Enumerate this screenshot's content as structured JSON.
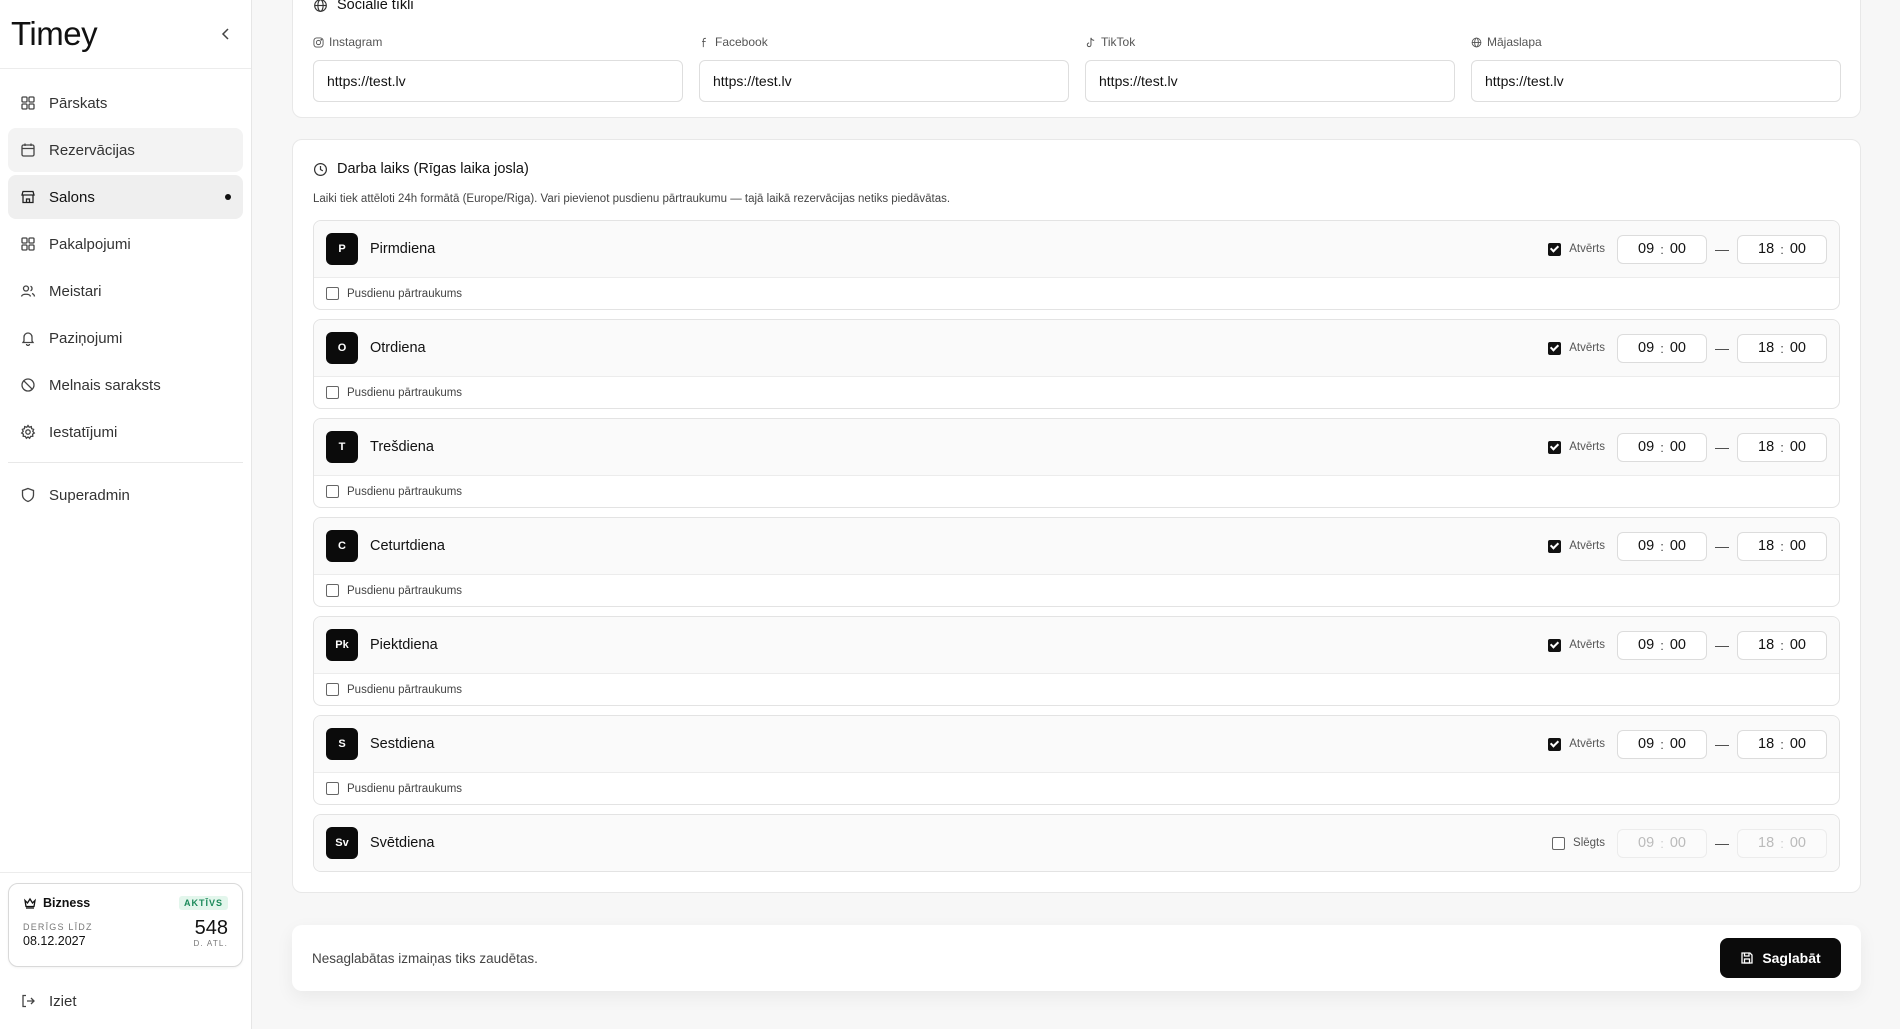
{
  "app": {
    "logo": "Timey"
  },
  "sidebar": {
    "items": [
      {
        "label": "Pārskats",
        "icon": "dashboard-icon"
      },
      {
        "label": "Rezervācijas",
        "icon": "calendar-icon"
      },
      {
        "label": "Salons",
        "icon": "store-icon",
        "active": true
      },
      {
        "label": "Pakalpojumi",
        "icon": "grid-icon"
      },
      {
        "label": "Meistari",
        "icon": "users-icon"
      },
      {
        "label": "Paziņojumi",
        "icon": "bell-icon"
      },
      {
        "label": "Melnais saraksts",
        "icon": "ban-icon"
      },
      {
        "label": "Iestatījumi",
        "icon": "gear-icon"
      }
    ],
    "superadmin": {
      "label": "Superadmin",
      "icon": "shield-icon"
    },
    "plan": {
      "name": "Bizness",
      "status": "AKTĪVS",
      "valid_label": "DERĪGS LĪDZ",
      "valid_date": "08.12.2027",
      "days_left": "548",
      "days_label": "D. ATL."
    },
    "logout": "Iziet"
  },
  "social": {
    "title": "Sociālie tīkli",
    "fields": [
      {
        "label": "Instagram",
        "value": "https://test.lv",
        "icon": "instagram-icon"
      },
      {
        "label": "Facebook",
        "value": "https://test.lv",
        "icon": "facebook-icon"
      },
      {
        "label": "TikTok",
        "value": "https://test.lv",
        "icon": "tiktok-icon"
      },
      {
        "label": "Mājaslapa",
        "value": "https://test.lv",
        "icon": "globe-icon"
      }
    ]
  },
  "hours": {
    "title": "Darba laiks (Rīgas laika josla)",
    "description": "Laiki tiek attēloti 24h formātā (Europe/Riga). Vari pievienot pusdienu pārtraukumu — tajā laikā rezervācijas netiks piedāvātas.",
    "break_label": "Pusdienu pārtraukums",
    "days": [
      {
        "letter": "P",
        "name": "Pirmdiena",
        "open": true,
        "status": "Atvērts",
        "from_h": "09",
        "from_m": "00",
        "to_h": "18",
        "to_m": "00"
      },
      {
        "letter": "O",
        "name": "Otrdiena",
        "open": true,
        "status": "Atvērts",
        "from_h": "09",
        "from_m": "00",
        "to_h": "18",
        "to_m": "00"
      },
      {
        "letter": "T",
        "name": "Trešdiena",
        "open": true,
        "status": "Atvērts",
        "from_h": "09",
        "from_m": "00",
        "to_h": "18",
        "to_m": "00"
      },
      {
        "letter": "C",
        "name": "Ceturtdiena",
        "open": true,
        "status": "Atvērts",
        "from_h": "09",
        "from_m": "00",
        "to_h": "18",
        "to_m": "00"
      },
      {
        "letter": "Pk",
        "name": "Piektdiena",
        "open": true,
        "status": "Atvērts",
        "from_h": "09",
        "from_m": "00",
        "to_h": "18",
        "to_m": "00"
      },
      {
        "letter": "S",
        "name": "Sestdiena",
        "open": true,
        "status": "Atvērts",
        "from_h": "09",
        "from_m": "00",
        "to_h": "18",
        "to_m": "00"
      },
      {
        "letter": "Sv",
        "name": "Svētdiena",
        "open": false,
        "status": "Slēgts",
        "from_h": "09",
        "from_m": "00",
        "to_h": "18",
        "to_m": "00"
      }
    ]
  },
  "save_bar": {
    "note": "Nesaglabātas izmaiņas tiks zaudētas.",
    "button": "Saglabāt"
  }
}
